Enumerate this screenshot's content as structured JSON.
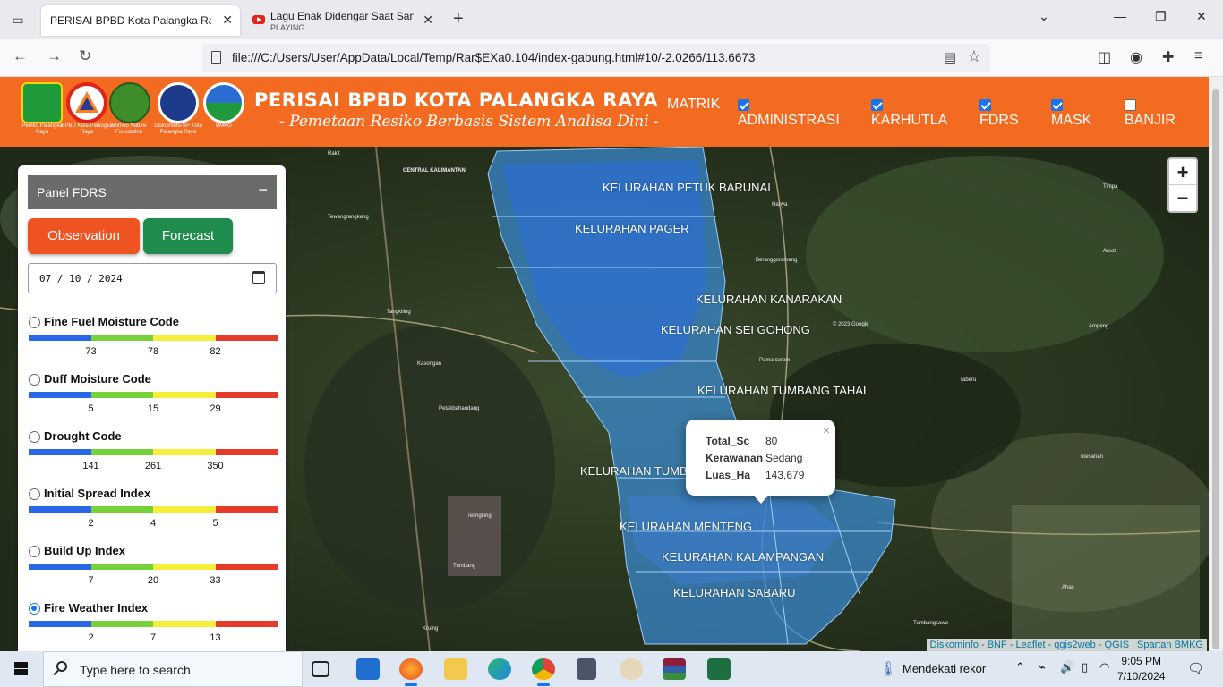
{
  "browser": {
    "tabs": [
      {
        "title": "PERISAI BPBD Kota Palangka Raya",
        "active": true
      },
      {
        "title": "Lagu Enak Didengar Saat Santai",
        "subtitle": "PLAYING",
        "active": false
      }
    ],
    "url": "file:///C:/Users/User/AppData/Local/Temp/Rar$EXa0.104/index-gabung.html#10/-2.0266/113.6673"
  },
  "header": {
    "logos": [
      {
        "caption": "Pemko Palangka Raya",
        "icon": "pemko-logo-icon"
      },
      {
        "caption": "BPBD Kota Palangka Raya",
        "icon": "bpbd-logo-icon"
      },
      {
        "caption": "Borneo Nature Foundation",
        "icon": "bnf-logo-icon"
      },
      {
        "caption": "Diskominfo-SP Kota Palangka Raya",
        "icon": "diskominfo-logo-icon"
      },
      {
        "caption": "BMKG",
        "icon": "bmkg-logo-icon"
      }
    ],
    "title": "PERISAI BPBD KOTA PALANGKA RAYA",
    "subtitle": "- Pemetaan Resiko Berbasis Sistem Analisa Dini -",
    "menu_matrik": "MATRIK",
    "layers": [
      {
        "label": "ADMINISTRASI",
        "checked": true
      },
      {
        "label": "KARHUTLA",
        "checked": true
      },
      {
        "label": "FDRS",
        "checked": true
      },
      {
        "label": "MASK",
        "checked": true
      },
      {
        "label": "BANJIR",
        "checked": false
      }
    ],
    "accent_color": "#f26b21"
  },
  "panel": {
    "title": "Panel FDRS",
    "collapse": "−",
    "observation_label": "Observation",
    "forecast_label": "Forecast",
    "date_value": "07 / 10 / 2024",
    "indices": [
      {
        "name": "Fine Fuel Moisture Code",
        "ticks": [
          "73",
          "78",
          "82"
        ],
        "selected": false
      },
      {
        "name": "Duff Moisture Code",
        "ticks": [
          "5",
          "15",
          "29"
        ],
        "selected": false
      },
      {
        "name": "Drought Code",
        "ticks": [
          "141",
          "261",
          "350"
        ],
        "selected": false
      },
      {
        "name": "Initial Spread Index",
        "ticks": [
          "2",
          "4",
          "5"
        ],
        "selected": false
      },
      {
        "name": "Build Up Index",
        "ticks": [
          "7",
          "20",
          "33"
        ],
        "selected": false
      },
      {
        "name": "Fire Weather Index",
        "ticks": [
          "2",
          "7",
          "13"
        ],
        "selected": true
      }
    ],
    "scale_colors": [
      "#2a66e8",
      "#76d23a",
      "#f5ee3a",
      "#e63a2a"
    ]
  },
  "map": {
    "zoom_in": "+",
    "zoom_out": "−",
    "kelurahan": [
      "KELURAHAN PETUK BARUNAI",
      "KELURAHAN PAGER",
      "KELURAHAN KANARAKAN",
      "KELURAHAN SEI GOHONG",
      "KELURAHAN TUMBANG TAHAI",
      "KELURAHAN TUMB",
      "KELURAHAN MENTENG",
      "KELURAHAN KALAMPANGAN",
      "KELURAHAN SABARU"
    ],
    "places": [
      "Rakit",
      "CENTRAL KALIMANTAN",
      "Tewangrangkang",
      "Tangkiling",
      "Kasongan",
      "Petakbahandang",
      "Telingking",
      "Tumbang",
      "Timpa",
      "Arcoti",
      "Ampeng",
      "Taberu",
      "Toesanan",
      "Ahas",
      "Tumbangsawo",
      "Kruing",
      "Hanya",
      "Pamarcorom",
      "Beranggoramang"
    ],
    "popup": {
      "rows": [
        {
          "key": "Total_Sc",
          "value": "80"
        },
        {
          "key": "Kerawanan",
          "value": "Sedang"
        },
        {
          "key": "Luas_Ha",
          "value": "143,679"
        }
      ],
      "close": "×"
    },
    "attribution": "Diskominfo - BNF - Leaflet - qgis2web - QGIS | Spartan BMKG",
    "watermark": "© 2023 Google"
  },
  "taskbar": {
    "search_placeholder": "Type here to search",
    "weather": "Mendekati rekor",
    "time": "9:05 PM",
    "date": "7/10/2024",
    "apps": [
      "task-view-icon",
      "mail-icon",
      "firefox-icon",
      "file-explorer-icon",
      "edge-icon",
      "chrome-icon",
      "calculator-icon",
      "paint-icon",
      "winrar-icon",
      "excel-icon"
    ]
  }
}
